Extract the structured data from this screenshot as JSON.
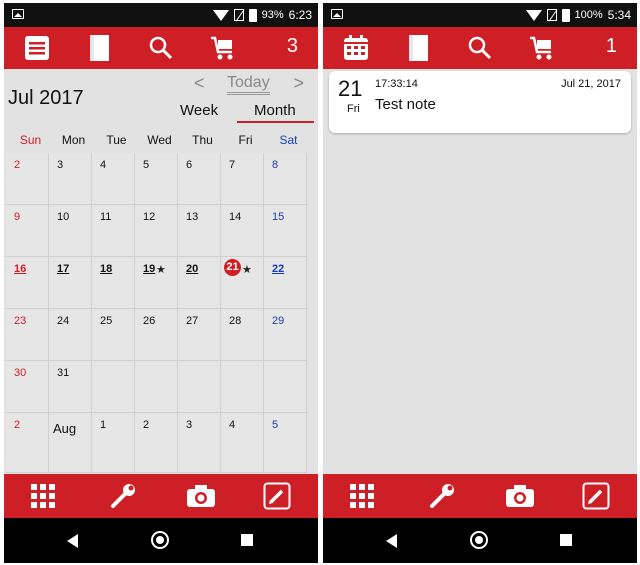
{
  "colors": {
    "accent": "#cf1f26",
    "sunday": "#cf1f26",
    "saturday": "#1a3fb0",
    "background": "#e2e2e2"
  },
  "left": {
    "status": {
      "battery": "93%",
      "time": "6:23"
    },
    "appbar": {
      "icons": [
        "list-icon",
        "notebook-icon",
        "search-icon",
        "cart-icon"
      ],
      "count": "3"
    },
    "calendar": {
      "month_title": "Jul 2017",
      "nav": {
        "prev": "<",
        "today": "Today",
        "next": ">"
      },
      "tabs": {
        "week": "Week",
        "month": "Month"
      },
      "weekdays": [
        "Sun",
        "Mon",
        "Tue",
        "Wed",
        "Thu",
        "Fri",
        "Sat"
      ],
      "weeks": [
        [
          "2",
          "3",
          "4",
          "5",
          "6",
          "7",
          "8"
        ],
        [
          "9",
          "10",
          "11",
          "12",
          "13",
          "14",
          "15"
        ],
        [
          "16",
          "17",
          "18",
          "19",
          "20",
          "21",
          "22"
        ],
        [
          "23",
          "24",
          "25",
          "26",
          "27",
          "28",
          "29"
        ],
        [
          "30",
          "31",
          "",
          "",
          "",
          "",
          ""
        ],
        [
          "2",
          "Aug",
          "1",
          "2",
          "3",
          "4",
          "5"
        ]
      ],
      "star": "★"
    },
    "bottombar": {
      "icons": [
        "grid-icon",
        "wrench-icon",
        "camera-icon",
        "edit-icon"
      ]
    }
  },
  "right": {
    "status": {
      "battery": "100%",
      "time": "5:34"
    },
    "appbar": {
      "icons": [
        "calendar-icon",
        "notebook-icon",
        "search-icon",
        "cart-icon"
      ],
      "count": "1"
    },
    "note": {
      "day": "21",
      "weekday": "Fri",
      "time": "17:33:14",
      "date": "Jul 21, 2017",
      "title": "Test note"
    },
    "bottombar": {
      "icons": [
        "grid-icon",
        "wrench-icon",
        "camera-icon",
        "edit-icon"
      ]
    }
  }
}
